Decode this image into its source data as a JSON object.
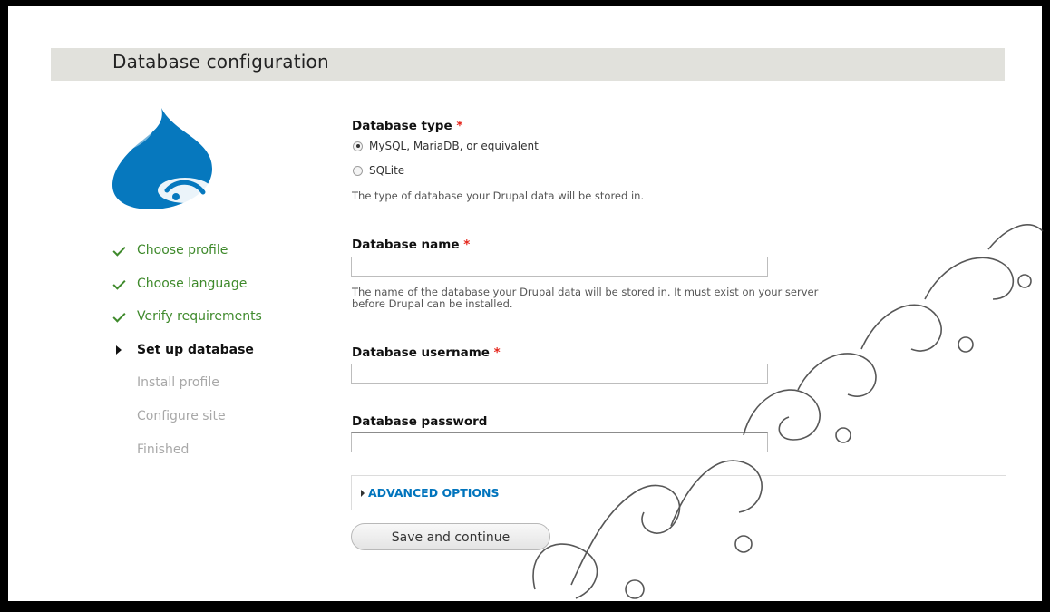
{
  "page": {
    "title": "Database configuration"
  },
  "steps": [
    {
      "label": "Choose profile",
      "state": "done",
      "icon": "check-icon"
    },
    {
      "label": "Choose language",
      "state": "done",
      "icon": "check-icon"
    },
    {
      "label": "Verify requirements",
      "state": "done",
      "icon": "check-icon"
    },
    {
      "label": "Set up database",
      "state": "active",
      "icon": "triangle-right-icon"
    },
    {
      "label": "Install profile",
      "state": "todo",
      "icon": ""
    },
    {
      "label": "Configure site",
      "state": "todo",
      "icon": ""
    },
    {
      "label": "Finished",
      "state": "todo",
      "icon": ""
    }
  ],
  "form": {
    "db_type": {
      "label": "Database type",
      "required_mark": "*",
      "options": [
        {
          "label": "MySQL, MariaDB, or equivalent",
          "selected": true
        },
        {
          "label": "SQLite",
          "selected": false
        }
      ],
      "description": "The type of database your Drupal data will be stored in."
    },
    "db_name": {
      "label": "Database name",
      "required_mark": "*",
      "value": "",
      "description_line1": "The name of the database your Drupal data will be stored in. It must exist on your server",
      "description_line2": "before Drupal can be installed."
    },
    "db_username": {
      "label": "Database username",
      "required_mark": "*",
      "value": ""
    },
    "db_password": {
      "label": "Database password",
      "value": ""
    },
    "advanced": {
      "label": "ADVANCED OPTIONS",
      "icon": "triangle-right-icon"
    },
    "submit_label": "Save and continue"
  },
  "colors": {
    "title_bar": "#e1e1dc",
    "done_step": "#3f8a2c",
    "required": "#e5261c",
    "link": "#0074bd",
    "logo": "#0678be"
  },
  "logo": {
    "icon": "drupal-drop-logo"
  },
  "watermark": {
    "icon": "watermark-stamp"
  }
}
